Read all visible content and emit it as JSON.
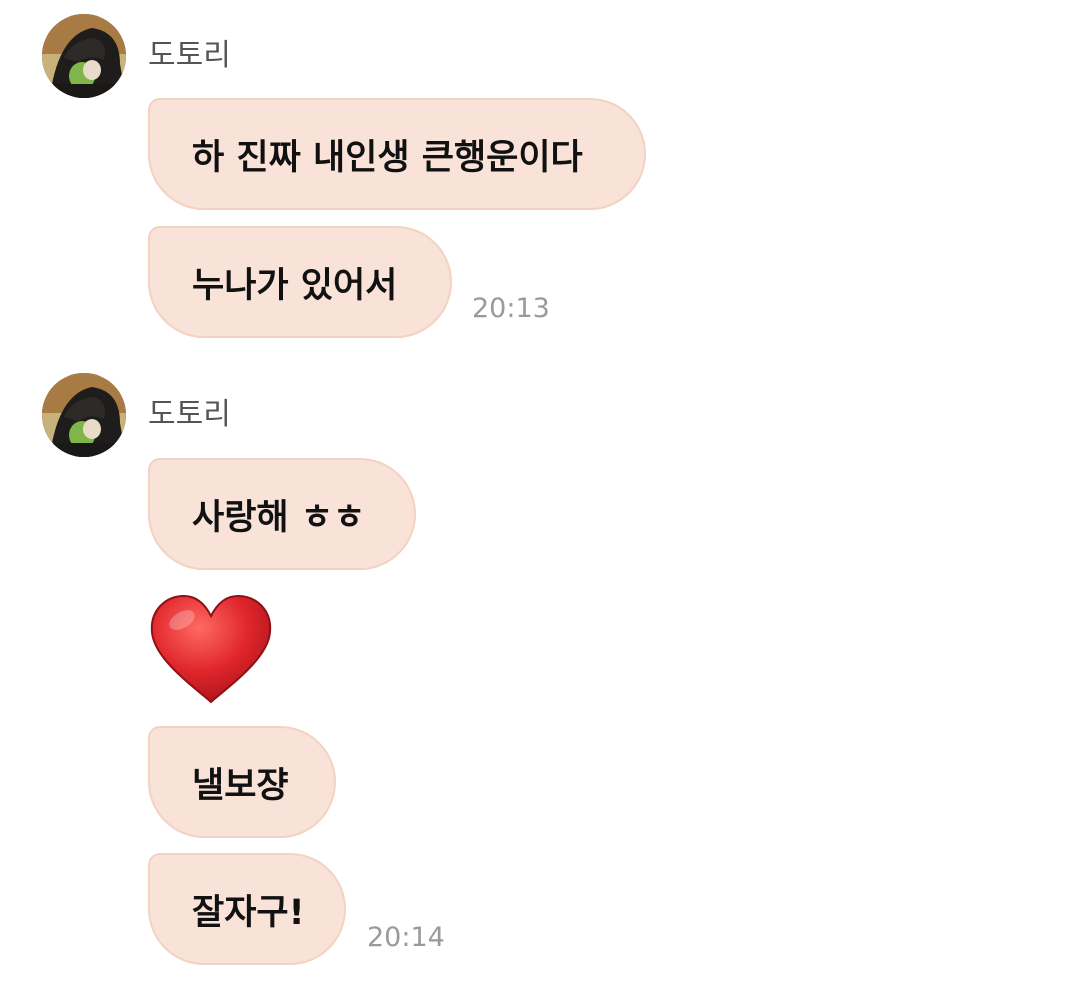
{
  "chat": {
    "groups": [
      {
        "sender": "도토리",
        "messages": [
          "하 진짜 내인생 큰행운이다",
          "누나가 있어서"
        ],
        "time": "20:13"
      },
      {
        "sender": "도토리",
        "messages": [
          "사랑해 ㅎㅎ",
          "낼보쟝",
          "잘자구!"
        ],
        "heart_emoji": "red-heart-emoji",
        "time": "20:14"
      }
    ]
  },
  "colors": {
    "bubble_bg": "#f9e3d9",
    "bubble_border": "#f3d2c2",
    "sender_text": "#555555",
    "time_text": "#9a9a9a",
    "heart": "#e0262c"
  }
}
